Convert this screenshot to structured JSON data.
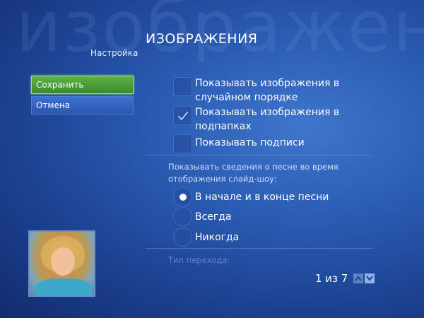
{
  "background_text": "изображения",
  "header": {
    "title": "ИЗОБРАЖЕНИЯ",
    "breadcrumb": "Настройка"
  },
  "left_panel": {
    "save_label": "Сохранить",
    "cancel_label": "Отмена"
  },
  "options": {
    "checkboxes": [
      {
        "label": "Показывать изображения в случайном порядке",
        "checked": false
      },
      {
        "label": "Показывать изображения в подпапках",
        "checked": true
      },
      {
        "label": "Показывать подписи",
        "checked": false
      }
    ],
    "song_info_label": "Показывать сведения о песне во время отображения слайд-шоу:",
    "radios": [
      {
        "label": "В начале и в конце песни",
        "selected": true
      },
      {
        "label": "Всегда",
        "selected": false
      },
      {
        "label": "Никогда",
        "selected": false
      }
    ],
    "transition_label": "Тип перехода:"
  },
  "pager": {
    "text": "1 из 7"
  },
  "colors": {
    "background": "#2a5bb2",
    "save_button": "#4da03a",
    "cancel_button": "#2f5fc0",
    "arrow": "#8fb2e6"
  },
  "icons": {
    "check": "checkmark-icon",
    "up": "arrow-up-icon",
    "down": "arrow-down-icon"
  }
}
